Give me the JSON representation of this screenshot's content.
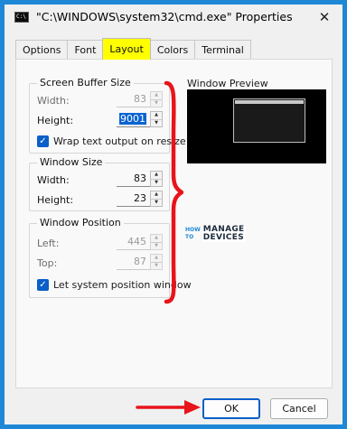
{
  "window": {
    "title": "\"C:\\WINDOWS\\system32\\cmd.exe\" Properties",
    "icon_text": "C:\\",
    "close_label": "✕"
  },
  "tabs": [
    {
      "label": "Options",
      "active": false
    },
    {
      "label": "Font",
      "active": false
    },
    {
      "label": "Layout",
      "active": true
    },
    {
      "label": "Colors",
      "active": false
    },
    {
      "label": "Terminal",
      "active": false
    }
  ],
  "screen_buffer": {
    "title": "Screen Buffer Size",
    "width_label": "Width:",
    "width_value": "83",
    "height_label": "Height:",
    "height_value": "9001",
    "wrap_label": "Wrap text output on resize",
    "wrap_checked": true
  },
  "window_size": {
    "title": "Window Size",
    "width_label": "Width:",
    "width_value": "83",
    "height_label": "Height:",
    "height_value": "23"
  },
  "window_position": {
    "title": "Window Position",
    "left_label": "Left:",
    "left_value": "445",
    "top_label": "Top:",
    "top_value": "87",
    "system_label": "Let system position window",
    "system_checked": true
  },
  "preview": {
    "label": "Window Preview"
  },
  "logo": {
    "how": "HOW",
    "to": "TO",
    "manage": "MANAGE",
    "devices": "DEVICES"
  },
  "buttons": {
    "ok": "OK",
    "cancel": "Cancel"
  },
  "annotation_color": "#e8141b",
  "accent_color": "#0a5fc8",
  "highlight_color": "#ffff00"
}
